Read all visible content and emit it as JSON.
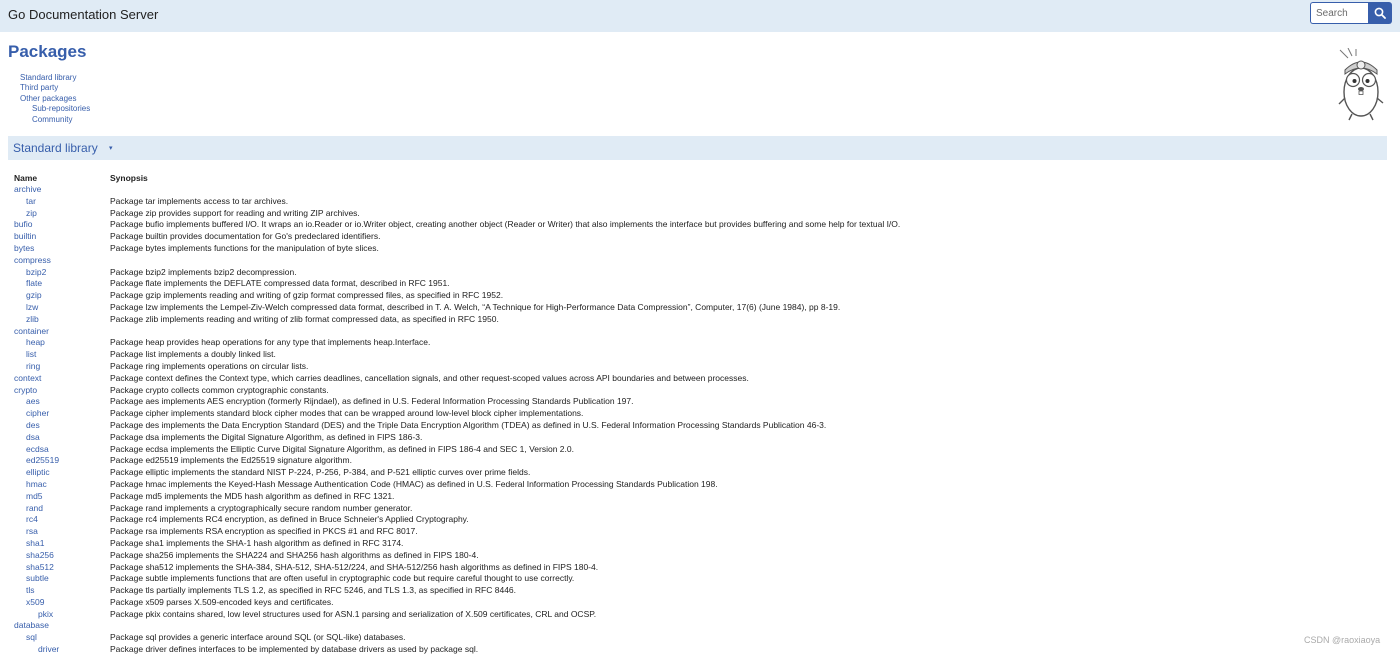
{
  "header": {
    "title": "Go Documentation Server",
    "search_placeholder": "Search"
  },
  "page": {
    "title": "Packages"
  },
  "toc": {
    "items": [
      "Standard library",
      "Third party",
      "Other packages"
    ],
    "subitems": [
      "Sub-repositories",
      "Community"
    ]
  },
  "section": {
    "title": "Standard library",
    "arrow": "▾"
  },
  "table": {
    "col_name": "Name",
    "col_synopsis": "Synopsis"
  },
  "packages": [
    {
      "name": "archive",
      "synopsis": "",
      "depth": 0
    },
    {
      "name": "tar",
      "synopsis": "Package tar implements access to tar archives.",
      "depth": 1
    },
    {
      "name": "zip",
      "synopsis": "Package zip provides support for reading and writing ZIP archives.",
      "depth": 1
    },
    {
      "name": "bufio",
      "synopsis": "Package bufio implements buffered I/O. It wraps an io.Reader or io.Writer object, creating another object (Reader or Writer) that also implements the interface but provides buffering and some help for textual I/O.",
      "depth": 0
    },
    {
      "name": "builtin",
      "synopsis": "Package builtin provides documentation for Go's predeclared identifiers.",
      "depth": 0
    },
    {
      "name": "bytes",
      "synopsis": "Package bytes implements functions for the manipulation of byte slices.",
      "depth": 0
    },
    {
      "name": "compress",
      "synopsis": "",
      "depth": 0
    },
    {
      "name": "bzip2",
      "synopsis": "Package bzip2 implements bzip2 decompression.",
      "depth": 1
    },
    {
      "name": "flate",
      "synopsis": "Package flate implements the DEFLATE compressed data format, described in RFC 1951.",
      "depth": 1
    },
    {
      "name": "gzip",
      "synopsis": "Package gzip implements reading and writing of gzip format compressed files, as specified in RFC 1952.",
      "depth": 1
    },
    {
      "name": "lzw",
      "synopsis": "Package lzw implements the Lempel-Ziv-Welch compressed data format, described in T. A. Welch, “A Technique for High-Performance Data Compression”, Computer, 17(6) (June 1984), pp 8-19.",
      "depth": 1
    },
    {
      "name": "zlib",
      "synopsis": "Package zlib implements reading and writing of zlib format compressed data, as specified in RFC 1950.",
      "depth": 1
    },
    {
      "name": "container",
      "synopsis": "",
      "depth": 0
    },
    {
      "name": "heap",
      "synopsis": "Package heap provides heap operations for any type that implements heap.Interface.",
      "depth": 1
    },
    {
      "name": "list",
      "synopsis": "Package list implements a doubly linked list.",
      "depth": 1
    },
    {
      "name": "ring",
      "synopsis": "Package ring implements operations on circular lists.",
      "depth": 1
    },
    {
      "name": "context",
      "synopsis": "Package context defines the Context type, which carries deadlines, cancellation signals, and other request-scoped values across API boundaries and between processes.",
      "depth": 0
    },
    {
      "name": "crypto",
      "synopsis": "Package crypto collects common cryptographic constants.",
      "depth": 0
    },
    {
      "name": "aes",
      "synopsis": "Package aes implements AES encryption (formerly Rijndael), as defined in U.S. Federal Information Processing Standards Publication 197.",
      "depth": 1
    },
    {
      "name": "cipher",
      "synopsis": "Package cipher implements standard block cipher modes that can be wrapped around low-level block cipher implementations.",
      "depth": 1
    },
    {
      "name": "des",
      "synopsis": "Package des implements the Data Encryption Standard (DES) and the Triple Data Encryption Algorithm (TDEA) as defined in U.S. Federal Information Processing Standards Publication 46-3.",
      "depth": 1
    },
    {
      "name": "dsa",
      "synopsis": "Package dsa implements the Digital Signature Algorithm, as defined in FIPS 186-3.",
      "depth": 1
    },
    {
      "name": "ecdsa",
      "synopsis": "Package ecdsa implements the Elliptic Curve Digital Signature Algorithm, as defined in FIPS 186-4 and SEC 1, Version 2.0.",
      "depth": 1
    },
    {
      "name": "ed25519",
      "synopsis": "Package ed25519 implements the Ed25519 signature algorithm.",
      "depth": 1
    },
    {
      "name": "elliptic",
      "synopsis": "Package elliptic implements the standard NIST P-224, P-256, P-384, and P-521 elliptic curves over prime fields.",
      "depth": 1
    },
    {
      "name": "hmac",
      "synopsis": "Package hmac implements the Keyed-Hash Message Authentication Code (HMAC) as defined in U.S. Federal Information Processing Standards Publication 198.",
      "depth": 1
    },
    {
      "name": "md5",
      "synopsis": "Package md5 implements the MD5 hash algorithm as defined in RFC 1321.",
      "depth": 1
    },
    {
      "name": "rand",
      "synopsis": "Package rand implements a cryptographically secure random number generator.",
      "depth": 1
    },
    {
      "name": "rc4",
      "synopsis": "Package rc4 implements RC4 encryption, as defined in Bruce Schneier's Applied Cryptography.",
      "depth": 1
    },
    {
      "name": "rsa",
      "synopsis": "Package rsa implements RSA encryption as specified in PKCS #1 and RFC 8017.",
      "depth": 1
    },
    {
      "name": "sha1",
      "synopsis": "Package sha1 implements the SHA-1 hash algorithm as defined in RFC 3174.",
      "depth": 1
    },
    {
      "name": "sha256",
      "synopsis": "Package sha256 implements the SHA224 and SHA256 hash algorithms as defined in FIPS 180-4.",
      "depth": 1
    },
    {
      "name": "sha512",
      "synopsis": "Package sha512 implements the SHA-384, SHA-512, SHA-512/224, and SHA-512/256 hash algorithms as defined in FIPS 180-4.",
      "depth": 1
    },
    {
      "name": "subtle",
      "synopsis": "Package subtle implements functions that are often useful in cryptographic code but require careful thought to use correctly.",
      "depth": 1
    },
    {
      "name": "tls",
      "synopsis": "Package tls partially implements TLS 1.2, as specified in RFC 5246, and TLS 1.3, as specified in RFC 8446.",
      "depth": 1
    },
    {
      "name": "x509",
      "synopsis": "Package x509 parses X.509-encoded keys and certificates.",
      "depth": 1
    },
    {
      "name": "pkix",
      "synopsis": "Package pkix contains shared, low level structures used for ASN.1 parsing and serialization of X.509 certificates, CRL and OCSP.",
      "depth": 2
    },
    {
      "name": "database",
      "synopsis": "",
      "depth": 0
    },
    {
      "name": "sql",
      "synopsis": "Package sql provides a generic interface around SQL (or SQL-like) databases.",
      "depth": 1
    },
    {
      "name": "driver",
      "synopsis": "Package driver defines interfaces to be implemented by database drivers as used by package sql.",
      "depth": 2
    }
  ],
  "watermark": "CSDN @raoxiaoya",
  "colors": {
    "link": "#375eab",
    "bar": "#e0ebf5",
    "text": "#222222"
  }
}
